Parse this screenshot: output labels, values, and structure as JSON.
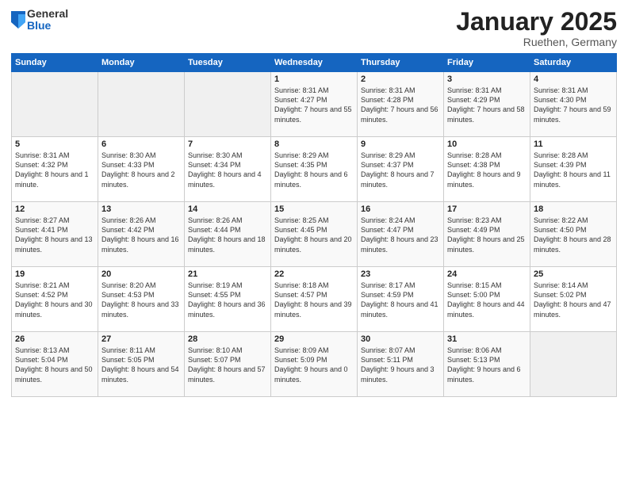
{
  "logo": {
    "general": "General",
    "blue": "Blue"
  },
  "title": "January 2025",
  "subtitle": "Ruethen, Germany",
  "days_header": [
    "Sunday",
    "Monday",
    "Tuesday",
    "Wednesday",
    "Thursday",
    "Friday",
    "Saturday"
  ],
  "weeks": [
    [
      {
        "day": "",
        "sunrise": "",
        "sunset": "",
        "daylight": ""
      },
      {
        "day": "",
        "sunrise": "",
        "sunset": "",
        "daylight": ""
      },
      {
        "day": "",
        "sunrise": "",
        "sunset": "",
        "daylight": ""
      },
      {
        "day": "1",
        "sunrise": "Sunrise: 8:31 AM",
        "sunset": "Sunset: 4:27 PM",
        "daylight": "Daylight: 7 hours and 55 minutes."
      },
      {
        "day": "2",
        "sunrise": "Sunrise: 8:31 AM",
        "sunset": "Sunset: 4:28 PM",
        "daylight": "Daylight: 7 hours and 56 minutes."
      },
      {
        "day": "3",
        "sunrise": "Sunrise: 8:31 AM",
        "sunset": "Sunset: 4:29 PM",
        "daylight": "Daylight: 7 hours and 58 minutes."
      },
      {
        "day": "4",
        "sunrise": "Sunrise: 8:31 AM",
        "sunset": "Sunset: 4:30 PM",
        "daylight": "Daylight: 7 hours and 59 minutes."
      }
    ],
    [
      {
        "day": "5",
        "sunrise": "Sunrise: 8:31 AM",
        "sunset": "Sunset: 4:32 PM",
        "daylight": "Daylight: 8 hours and 1 minute."
      },
      {
        "day": "6",
        "sunrise": "Sunrise: 8:30 AM",
        "sunset": "Sunset: 4:33 PM",
        "daylight": "Daylight: 8 hours and 2 minutes."
      },
      {
        "day": "7",
        "sunrise": "Sunrise: 8:30 AM",
        "sunset": "Sunset: 4:34 PM",
        "daylight": "Daylight: 8 hours and 4 minutes."
      },
      {
        "day": "8",
        "sunrise": "Sunrise: 8:29 AM",
        "sunset": "Sunset: 4:35 PM",
        "daylight": "Daylight: 8 hours and 6 minutes."
      },
      {
        "day": "9",
        "sunrise": "Sunrise: 8:29 AM",
        "sunset": "Sunset: 4:37 PM",
        "daylight": "Daylight: 8 hours and 7 minutes."
      },
      {
        "day": "10",
        "sunrise": "Sunrise: 8:28 AM",
        "sunset": "Sunset: 4:38 PM",
        "daylight": "Daylight: 8 hours and 9 minutes."
      },
      {
        "day": "11",
        "sunrise": "Sunrise: 8:28 AM",
        "sunset": "Sunset: 4:39 PM",
        "daylight": "Daylight: 8 hours and 11 minutes."
      }
    ],
    [
      {
        "day": "12",
        "sunrise": "Sunrise: 8:27 AM",
        "sunset": "Sunset: 4:41 PM",
        "daylight": "Daylight: 8 hours and 13 minutes."
      },
      {
        "day": "13",
        "sunrise": "Sunrise: 8:26 AM",
        "sunset": "Sunset: 4:42 PM",
        "daylight": "Daylight: 8 hours and 16 minutes."
      },
      {
        "day": "14",
        "sunrise": "Sunrise: 8:26 AM",
        "sunset": "Sunset: 4:44 PM",
        "daylight": "Daylight: 8 hours and 18 minutes."
      },
      {
        "day": "15",
        "sunrise": "Sunrise: 8:25 AM",
        "sunset": "Sunset: 4:45 PM",
        "daylight": "Daylight: 8 hours and 20 minutes."
      },
      {
        "day": "16",
        "sunrise": "Sunrise: 8:24 AM",
        "sunset": "Sunset: 4:47 PM",
        "daylight": "Daylight: 8 hours and 23 minutes."
      },
      {
        "day": "17",
        "sunrise": "Sunrise: 8:23 AM",
        "sunset": "Sunset: 4:49 PM",
        "daylight": "Daylight: 8 hours and 25 minutes."
      },
      {
        "day": "18",
        "sunrise": "Sunrise: 8:22 AM",
        "sunset": "Sunset: 4:50 PM",
        "daylight": "Daylight: 8 hours and 28 minutes."
      }
    ],
    [
      {
        "day": "19",
        "sunrise": "Sunrise: 8:21 AM",
        "sunset": "Sunset: 4:52 PM",
        "daylight": "Daylight: 8 hours and 30 minutes."
      },
      {
        "day": "20",
        "sunrise": "Sunrise: 8:20 AM",
        "sunset": "Sunset: 4:53 PM",
        "daylight": "Daylight: 8 hours and 33 minutes."
      },
      {
        "day": "21",
        "sunrise": "Sunrise: 8:19 AM",
        "sunset": "Sunset: 4:55 PM",
        "daylight": "Daylight: 8 hours and 36 minutes."
      },
      {
        "day": "22",
        "sunrise": "Sunrise: 8:18 AM",
        "sunset": "Sunset: 4:57 PM",
        "daylight": "Daylight: 8 hours and 39 minutes."
      },
      {
        "day": "23",
        "sunrise": "Sunrise: 8:17 AM",
        "sunset": "Sunset: 4:59 PM",
        "daylight": "Daylight: 8 hours and 41 minutes."
      },
      {
        "day": "24",
        "sunrise": "Sunrise: 8:15 AM",
        "sunset": "Sunset: 5:00 PM",
        "daylight": "Daylight: 8 hours and 44 minutes."
      },
      {
        "day": "25",
        "sunrise": "Sunrise: 8:14 AM",
        "sunset": "Sunset: 5:02 PM",
        "daylight": "Daylight: 8 hours and 47 minutes."
      }
    ],
    [
      {
        "day": "26",
        "sunrise": "Sunrise: 8:13 AM",
        "sunset": "Sunset: 5:04 PM",
        "daylight": "Daylight: 8 hours and 50 minutes."
      },
      {
        "day": "27",
        "sunrise": "Sunrise: 8:11 AM",
        "sunset": "Sunset: 5:05 PM",
        "daylight": "Daylight: 8 hours and 54 minutes."
      },
      {
        "day": "28",
        "sunrise": "Sunrise: 8:10 AM",
        "sunset": "Sunset: 5:07 PM",
        "daylight": "Daylight: 8 hours and 57 minutes."
      },
      {
        "day": "29",
        "sunrise": "Sunrise: 8:09 AM",
        "sunset": "Sunset: 5:09 PM",
        "daylight": "Daylight: 9 hours and 0 minutes."
      },
      {
        "day": "30",
        "sunrise": "Sunrise: 8:07 AM",
        "sunset": "Sunset: 5:11 PM",
        "daylight": "Daylight: 9 hours and 3 minutes."
      },
      {
        "day": "31",
        "sunrise": "Sunrise: 8:06 AM",
        "sunset": "Sunset: 5:13 PM",
        "daylight": "Daylight: 9 hours and 6 minutes."
      },
      {
        "day": "",
        "sunrise": "",
        "sunset": "",
        "daylight": ""
      }
    ]
  ]
}
